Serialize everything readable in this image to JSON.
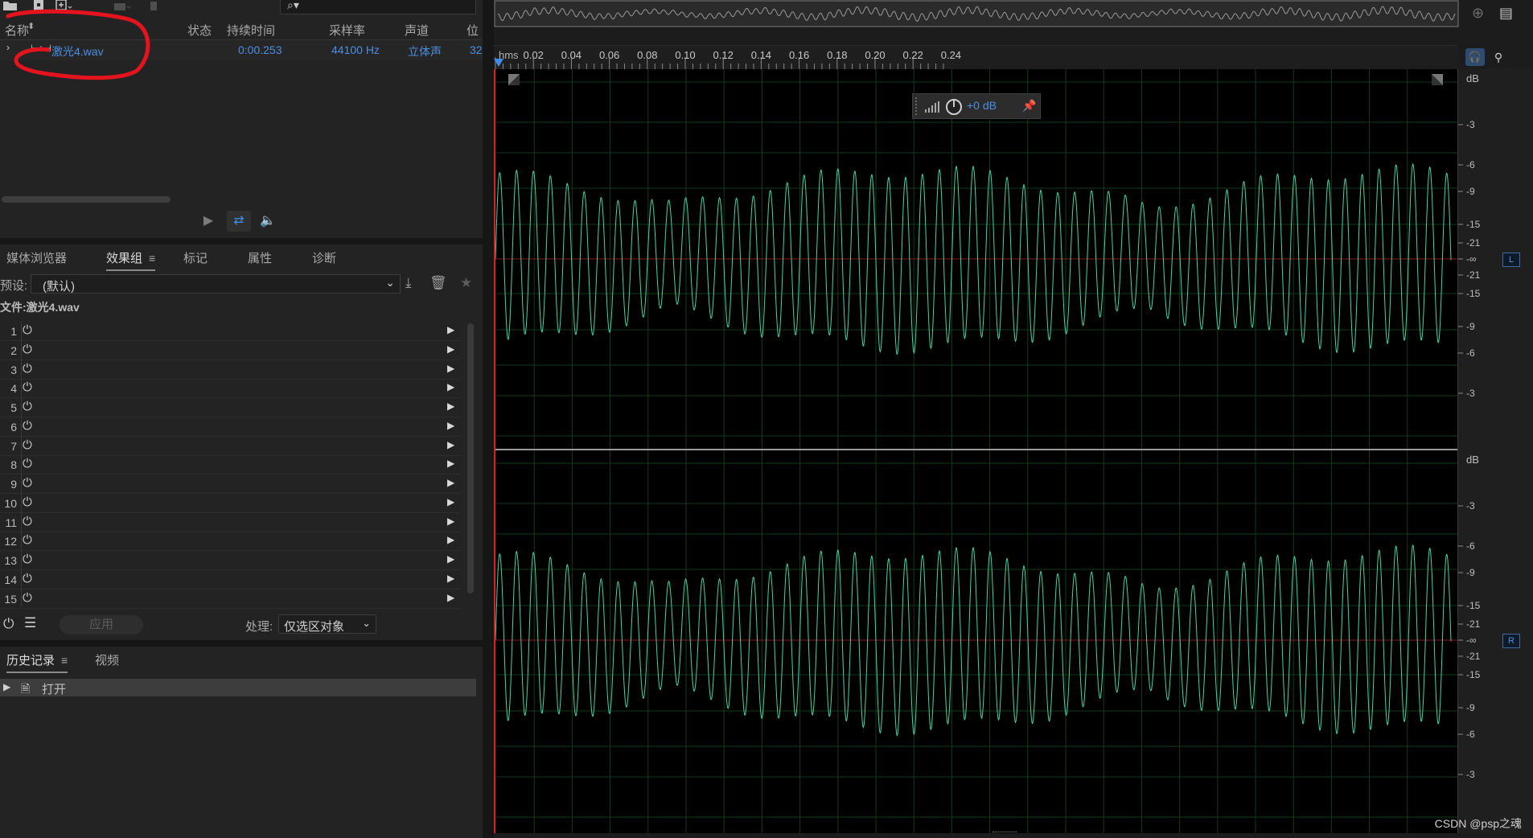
{
  "files_panel": {
    "columns": {
      "name": "名称",
      "status": "状态",
      "duration": "持续时间",
      "sample_rate": "采样率",
      "channels": "声道",
      "bits": "位"
    },
    "file": {
      "name": "激光4.wav",
      "duration": "0:00.253",
      "sample_rate": "44100 Hz",
      "channels": "立体声",
      "bits": "32"
    },
    "search_glyph": "⌕▾"
  },
  "effects_panel": {
    "tabs": [
      "媒体浏览器",
      "效果组",
      "标记",
      "属性",
      "诊断"
    ],
    "active_tab": "效果组",
    "preset_label": "预设:",
    "preset_value": "(默认)",
    "file_title": "文件:激光4.wav",
    "slots": [
      "1",
      "2",
      "3",
      "4",
      "5",
      "6",
      "7",
      "8",
      "9",
      "10",
      "11",
      "12",
      "13",
      "14",
      "15"
    ],
    "apply_label": "应用",
    "process_label": "处理:",
    "process_value": "仅选区对象"
  },
  "history_panel": {
    "tabs": [
      "历史记录",
      "视频"
    ],
    "active_tab": "历史记录",
    "items": [
      "打开"
    ]
  },
  "editor": {
    "ruler_unit": "hms",
    "ruler_ticks": [
      "0.02",
      "0.04",
      "0.06",
      "0.08",
      "0.10",
      "0.12",
      "0.14",
      "0.16",
      "0.18",
      "0.20",
      "0.22",
      "0.24"
    ],
    "hud_gain": "+0 dB",
    "db_header": "dB",
    "db_labels": [
      "-3",
      "-6",
      "-9",
      "-15",
      "-21",
      "-∞",
      "-21",
      "-15",
      "-9",
      "-6",
      "-3"
    ],
    "channels": [
      "L",
      "R"
    ]
  },
  "watermark": "CSDN @psp之魂",
  "colors": {
    "waveform": "#3fd6a6",
    "accent": "#4a8fe3",
    "annotation": "#e3141e",
    "playhead": "#e02020"
  }
}
